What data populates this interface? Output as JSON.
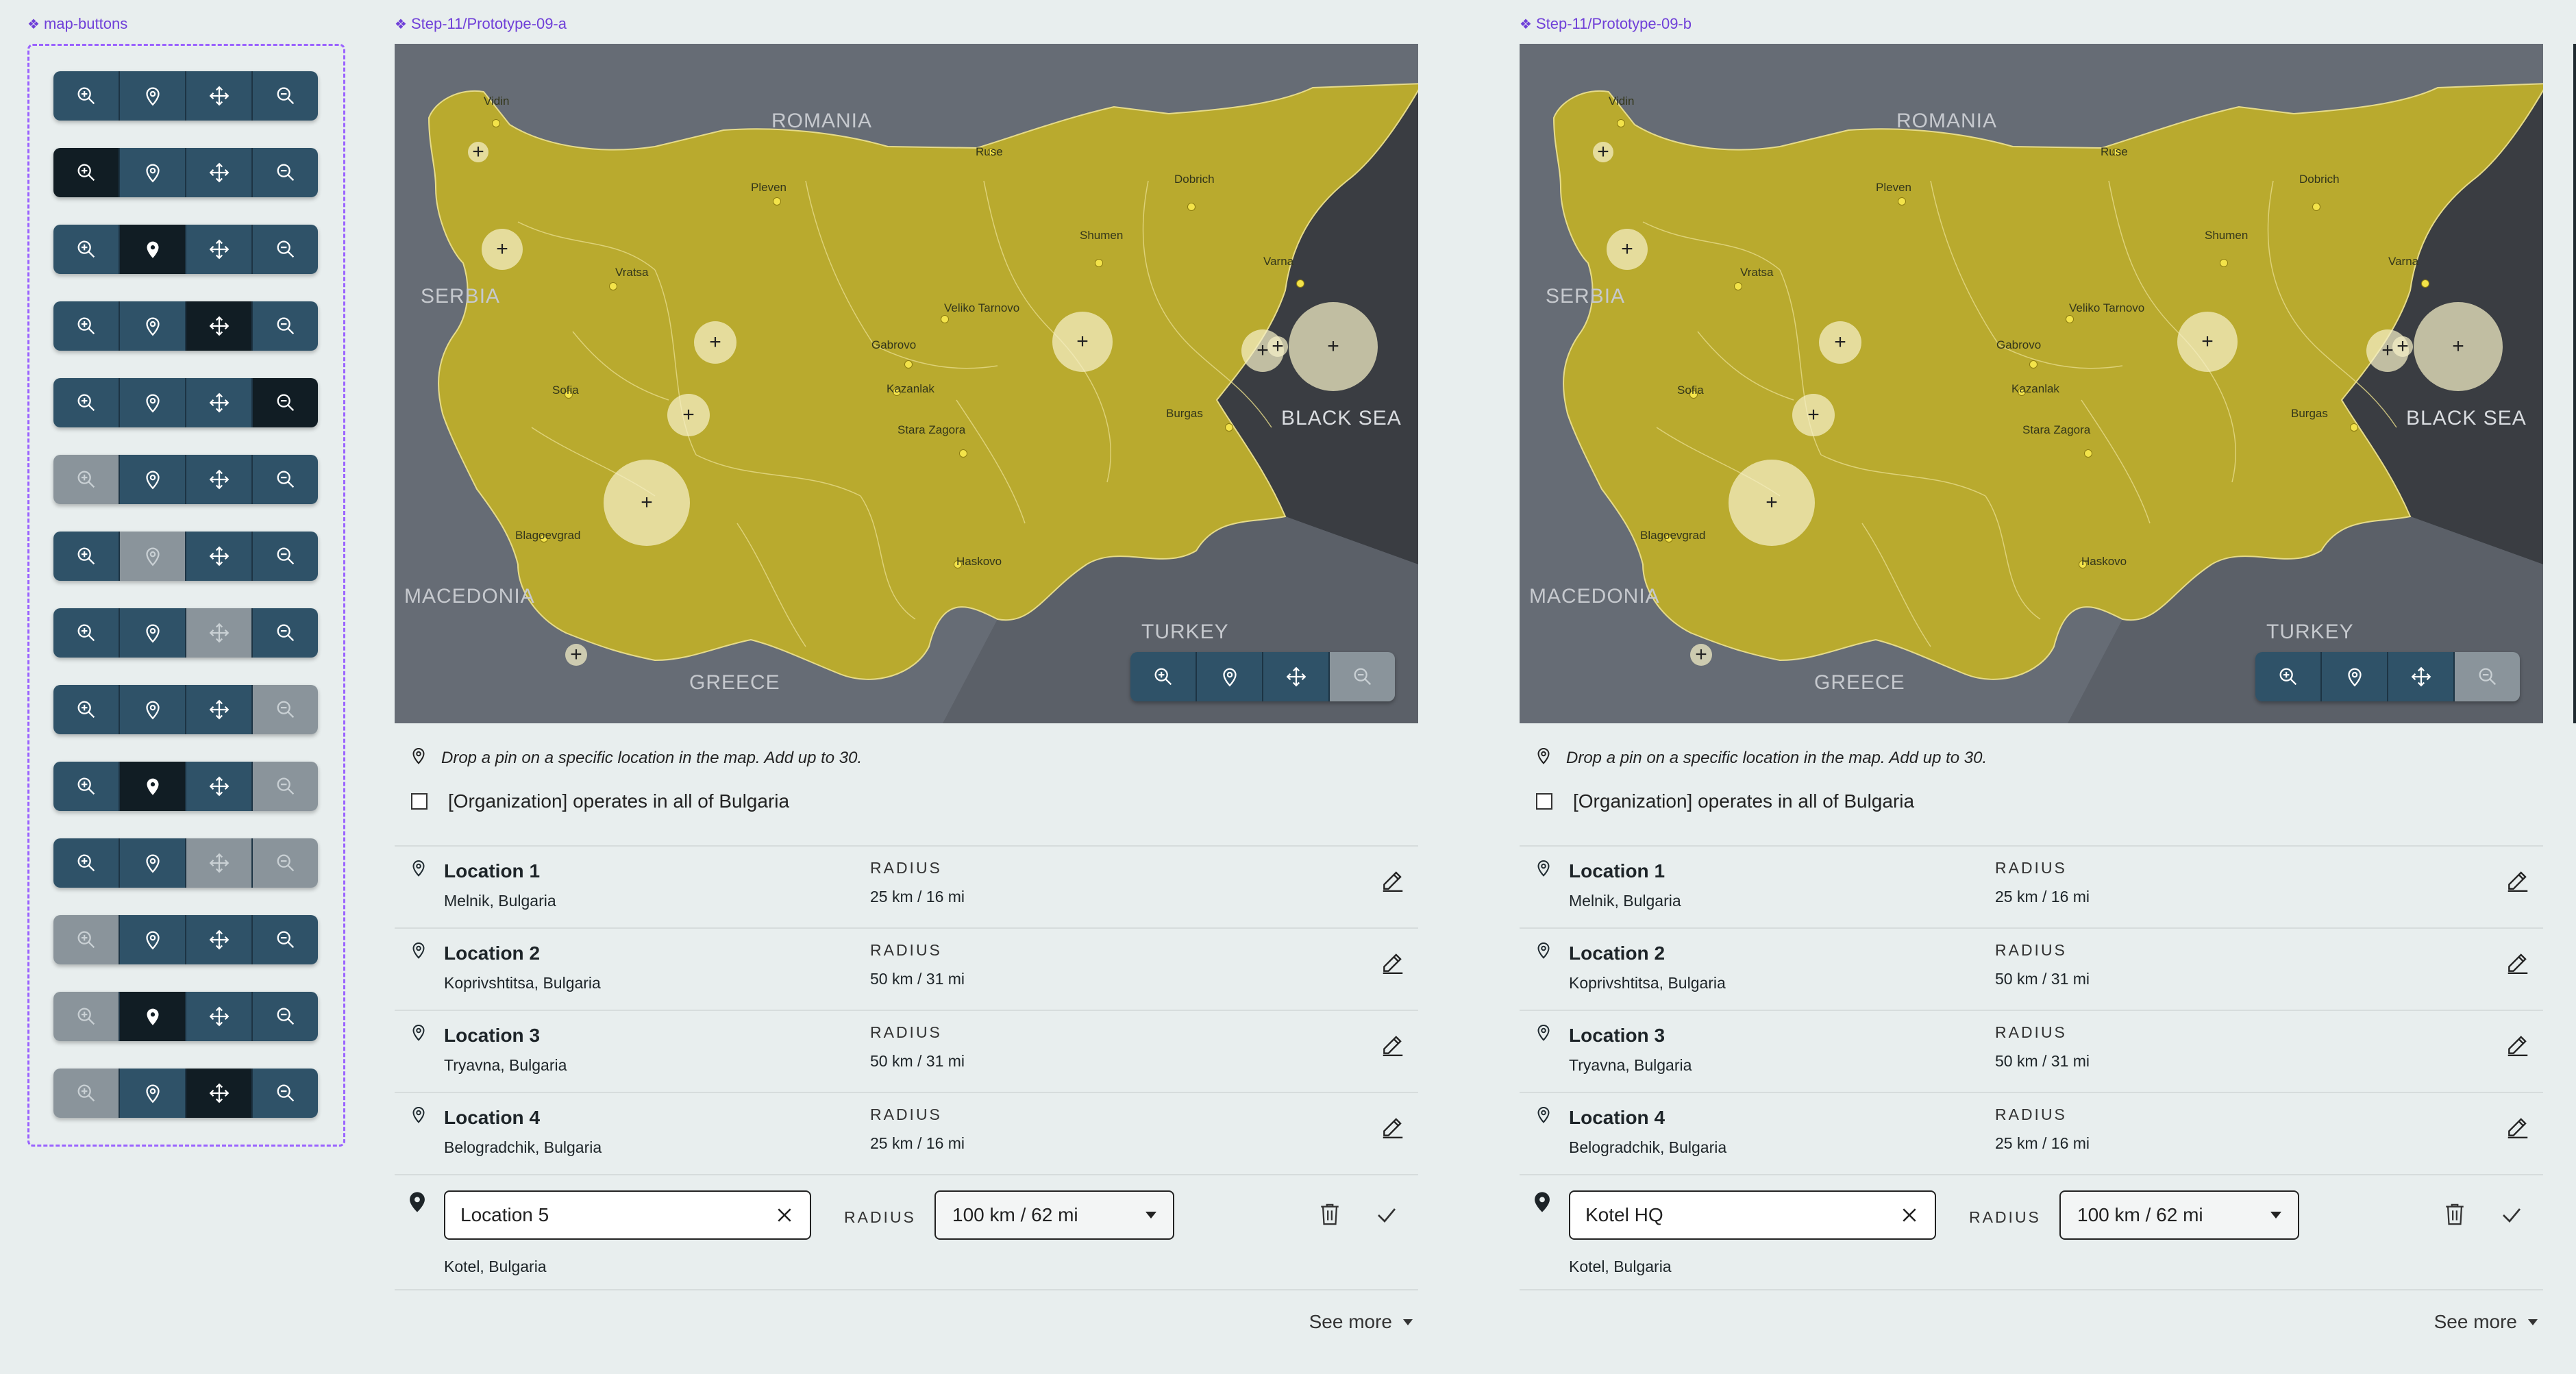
{
  "component_set": {
    "label": "map-buttons",
    "variants": [
      {
        "states": [
          "default",
          "default",
          "default",
          "default"
        ]
      },
      {
        "states": [
          "active",
          "default",
          "default",
          "default"
        ]
      },
      {
        "states": [
          "default",
          "active",
          "default",
          "default"
        ]
      },
      {
        "states": [
          "default",
          "default",
          "active",
          "default"
        ]
      },
      {
        "states": [
          "default",
          "default",
          "default",
          "active"
        ]
      },
      {
        "states": [
          "disabled",
          "default",
          "default",
          "default"
        ]
      },
      {
        "states": [
          "default",
          "disabled",
          "default",
          "default"
        ]
      },
      {
        "states": [
          "default",
          "default",
          "disabled",
          "default"
        ]
      },
      {
        "states": [
          "default",
          "default",
          "default",
          "disabled"
        ]
      },
      {
        "states": [
          "default",
          "active",
          "default",
          "disabled"
        ]
      },
      {
        "states": [
          "default",
          "default",
          "disabled",
          "disabled"
        ]
      },
      {
        "states": [
          "disabled",
          "default",
          "default",
          "default"
        ]
      },
      {
        "states": [
          "disabled",
          "active",
          "default",
          "default"
        ]
      },
      {
        "states": [
          "disabled",
          "default",
          "active",
          "default"
        ]
      }
    ],
    "button_icons": [
      "zoom-in-icon",
      "map-pin-icon",
      "move-icon",
      "zoom-out-icon"
    ]
  },
  "colors": {
    "button_default": "#2f5268",
    "button_active": "#111d24",
    "button_disabled": "#8a949b",
    "land": "#b9aa2e",
    "neighbour": "#666c75",
    "sea": "#3a3d42",
    "frame_label": "#6f3fd8"
  },
  "prototypes": [
    {
      "label": "Step-11/Prototype-09-a",
      "map": {
        "countries": [
          "ROMANIA",
          "SERBIA",
          "MACEDONIA",
          "GREECE",
          "TURKEY"
        ],
        "sea": "BLACK SEA",
        "cities": [
          "Vidin",
          "Ruse",
          "Pleven",
          "Dobrich",
          "Shumen",
          "Vratsa",
          "Varna",
          "Veliko Tarnovo",
          "Gabrovo",
          "Sofia",
          "Kazanlak",
          "Burgas",
          "Stara Zagora",
          "Blagoevgrad",
          "Haskovo"
        ],
        "controls": [
          "default",
          "default",
          "default",
          "disabled"
        ]
      },
      "hint": "Drop a pin on a specific location in the map. Add up to 30.",
      "operates_all": {
        "label": "[Organization] operates in all of Bulgaria",
        "checked": false
      },
      "radius_label": "RADIUS",
      "locations": [
        {
          "name": "Location 1",
          "place": "Melnik, Bulgaria",
          "radius": "25 km / 16 mi"
        },
        {
          "name": "Location 2",
          "place": "Koprivshtitsa, Bulgaria",
          "radius": "50 km / 31 mi"
        },
        {
          "name": "Location 3",
          "place": "Tryavna, Bulgaria",
          "radius": "50 km / 31 mi"
        },
        {
          "name": "Location 4",
          "place": "Belogradchik, Bulgaria",
          "radius": "25 km / 16 mi"
        }
      ],
      "editing": {
        "name_value": "Location 5",
        "place": "Kotel, Bulgaria",
        "radius_value": "100 km / 62 mi"
      },
      "see_more": "See more"
    },
    {
      "label": "Step-11/Prototype-09-b",
      "map": {
        "countries": [
          "ROMANIA",
          "SERBIA",
          "MACEDONIA",
          "GREECE",
          "TURKEY"
        ],
        "sea": "BLACK SEA",
        "cities": [
          "Vidin",
          "Ruse",
          "Pleven",
          "Dobrich",
          "Shumen",
          "Vratsa",
          "Varna",
          "Veliko Tarnovo",
          "Gabrovo",
          "Sofia",
          "Kazanlak",
          "Burgas",
          "Stara Zagora",
          "Blagoevgrad",
          "Haskovo"
        ],
        "controls": [
          "default",
          "default",
          "default",
          "disabled"
        ]
      },
      "hint": "Drop a pin on a specific location in the map. Add up to 30.",
      "operates_all": {
        "label": "[Organization] operates in all of Bulgaria",
        "checked": false
      },
      "radius_label": "RADIUS",
      "locations": [
        {
          "name": "Location 1",
          "place": "Melnik, Bulgaria",
          "radius": "25 km / 16 mi"
        },
        {
          "name": "Location 2",
          "place": "Koprivshtitsa, Bulgaria",
          "radius": "50 km / 31 mi"
        },
        {
          "name": "Location 3",
          "place": "Tryavna, Bulgaria",
          "radius": "50 km / 31 mi"
        },
        {
          "name": "Location 4",
          "place": "Belogradchik, Bulgaria",
          "radius": "25 km / 16 mi"
        }
      ],
      "editing": {
        "name_value": "Kotel HQ",
        "place": "Kotel, Bulgaria",
        "radius_value": "100 km / 62 mi"
      },
      "see_more": "See more"
    }
  ]
}
